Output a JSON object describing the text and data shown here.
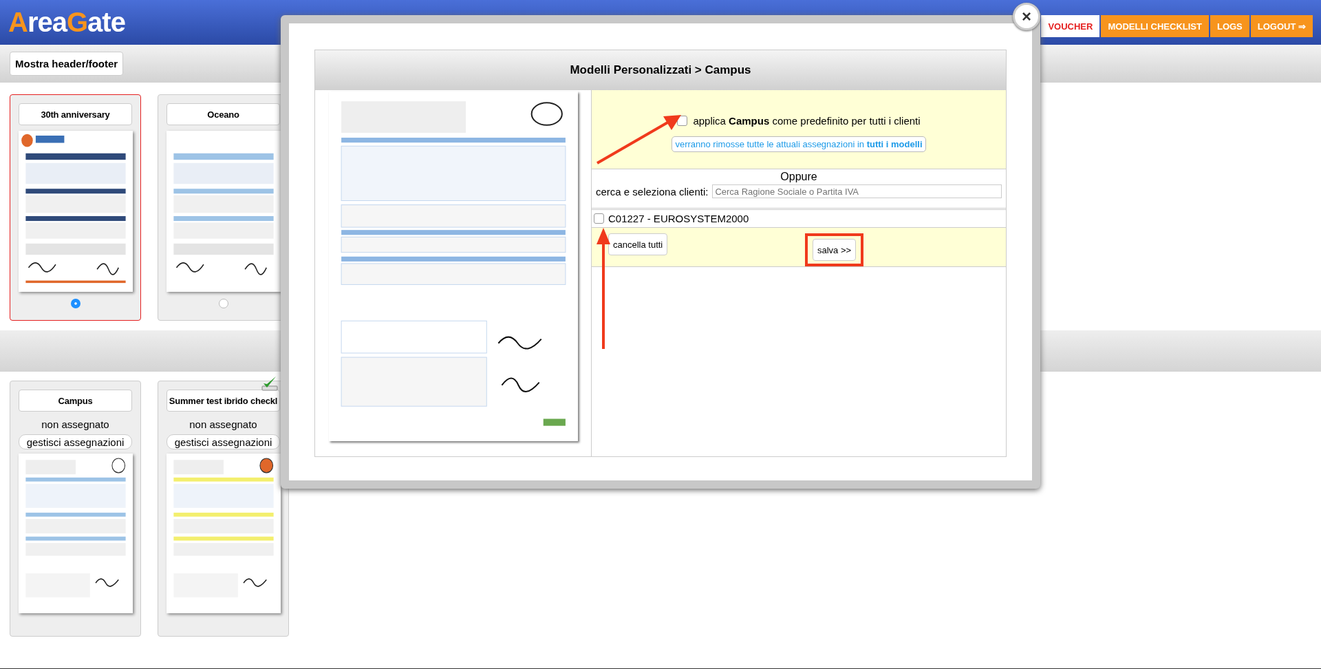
{
  "header": {
    "logo": [
      {
        "text": "A",
        "accent": true
      },
      {
        "text": "rea",
        "accent": false
      },
      {
        "text": "G",
        "accent": true
      },
      {
        "text": "ate",
        "accent": false
      }
    ],
    "nav": [
      {
        "label": "VOUCHER",
        "selected": true
      },
      {
        "label": "MODELLI CHECKLIST",
        "selected": false
      },
      {
        "label": "LOGS",
        "selected": false
      },
      {
        "label": "LOGOUT ⇒",
        "selected": false
      }
    ]
  },
  "toolbar": {
    "button": "Mostra header/footer"
  },
  "default_templates": [
    {
      "title": "30th anniversary",
      "selected": true
    },
    {
      "title": "Oceano",
      "selected": false
    }
  ],
  "custom_templates": [
    {
      "title": "Campus",
      "status": "non assegnato",
      "action": "gestisci assegnazioni",
      "checked": false
    },
    {
      "title": "Summer test ibrido checkl",
      "status": "non assegnato",
      "action": "gestisci assegnazioni",
      "checked": true
    }
  ],
  "dialog": {
    "close": "×",
    "title": "Modelli Personalizzati > Campus",
    "apply_default": {
      "label": "applica **Campus** come predefinito per tutti i clienti",
      "checked": false
    },
    "warning": "verranno rimosse tutte le attuali assegnazioni in **tutti i modelli**",
    "separator": "Oppure",
    "search_label": "cerca e seleziona clienti:",
    "search": {
      "placeholder": "Cerca Ragione Sociale o Partita IVA"
    },
    "clients": [
      {
        "label": "C01227 - EUROSYSTEM2000",
        "checked": false
      }
    ],
    "clear_button": "cancella tutti",
    "save_button": "salva >>"
  }
}
